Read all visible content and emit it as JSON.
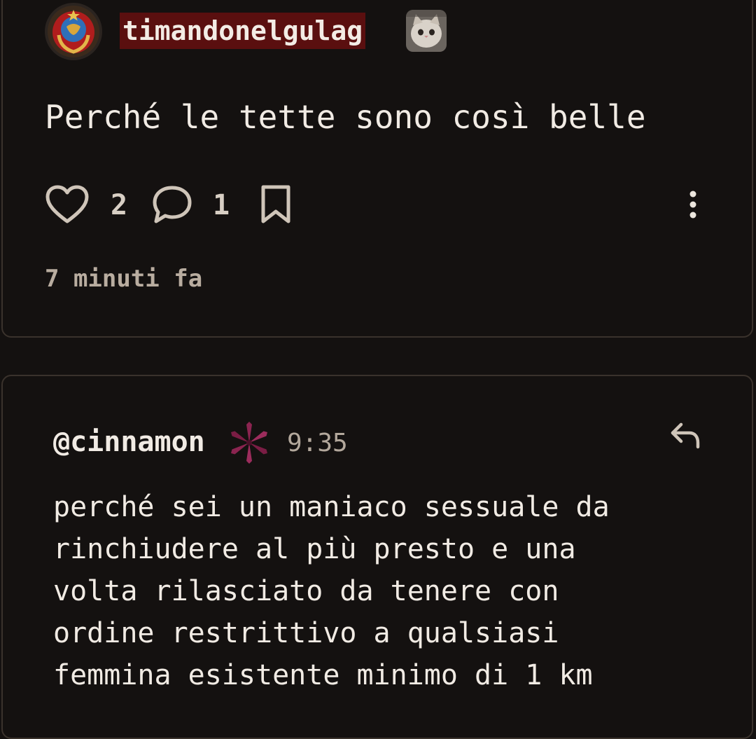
{
  "post": {
    "username": "timandonelgulag",
    "text": "Perché le tette sono così belle",
    "likes": "2",
    "comments": "1",
    "time": "7 minuti fa"
  },
  "comment": {
    "author": "@cinnamon",
    "time": "9:35",
    "lines": [
      "perché sei un maniaco sessuale da",
      "rinchiudere al più presto e una",
      "volta rilasciato da tenere con",
      "ordine restrittivo a qualsiasi",
      "femmina esistente minimo di 1 km"
    ]
  },
  "icons": {
    "like": "heart-icon",
    "comment": "speech-bubble-icon",
    "save": "bookmark-icon",
    "more": "vertical-dots-icon",
    "reply": "reply-arrow-icon"
  },
  "colors": {
    "background": "#141110",
    "username_badge": "#5a0f0f",
    "icon": "#cfc5b9"
  }
}
